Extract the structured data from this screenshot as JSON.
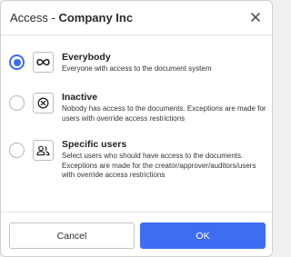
{
  "dialog": {
    "title_prefix": "Access - ",
    "title_company": "Company Inc",
    "close_icon": "close-icon"
  },
  "options": [
    {
      "title": "Everybody",
      "description": "Everyone with access to the document system",
      "icon": "infinity-icon",
      "selected": true
    },
    {
      "title": "Inactive",
      "description": "Nobody has access to the documents. Exceptions are made for users with override access restrictions",
      "icon": "circle-x-icon",
      "selected": false
    },
    {
      "title": "Specific users",
      "description": "Select users who should have access to the documents. Exceptions are made for the creator/approver/auditors/users with override access restrictions",
      "icon": "users-icon",
      "selected": false
    }
  ],
  "footer": {
    "cancel_label": "Cancel",
    "ok_label": "OK"
  },
  "colors": {
    "accent": "#3e6df4",
    "text": "#2b2b2b",
    "border": "#cfcfcf"
  }
}
